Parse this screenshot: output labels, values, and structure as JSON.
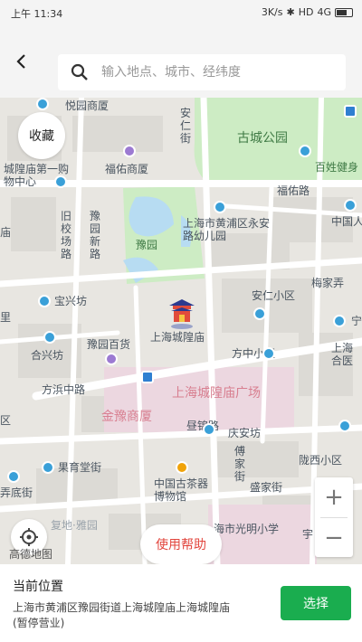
{
  "statusbar": {
    "time": "上午 11:34",
    "network": "3K/s",
    "hd": "HD",
    "signal": "4G"
  },
  "search": {
    "placeholder": "输入地点、城市、经纬度"
  },
  "map": {
    "favorite_label": "收藏",
    "help_label": "使用帮助",
    "labels": {
      "yuyuan_rest": "悦园商厦",
      "anren": "安仁街",
      "gucheng": "古城公园",
      "fuyou": "福佑商厦",
      "baixing": "百姓健身",
      "chenghuang_sh": "城隍庙第一购物中心",
      "fuyou_road": "福佑路",
      "zhongguoren": "中国人",
      "yuyuan_garden": "豫园",
      "jiuxiao": "旧校场路",
      "yuyuanxinlu": "豫园新路",
      "huangpu_kg": "上海市黄浦区永安路幼儿园",
      "miao": "庙",
      "baoxing": "宝兴坊",
      "anren_xq": "安仁小区",
      "meijia": "梅家弄",
      "li": "里",
      "ning": "宁",
      "hexing": "合兴坊",
      "yuyuan_bh": "豫园百货",
      "chenghuangmiao": "上海城隍庙",
      "fangzhong": "方中小区",
      "shanghai_he": "上海合医",
      "fangbang": "方浜中路",
      "chm_square": "上海城隍庙广场",
      "jinyu": "金豫商厦",
      "chanyuan": "昼锦路",
      "qu": "区",
      "qingan": "庆安坊",
      "fuxing": "傅家街",
      "longmen": "陇西小区",
      "guoyuan": "果育堂街",
      "nong": "弄底街",
      "tea": "中国古茶器博物馆",
      "shengjia": "盛家街",
      "fuxing_ya": "复地·雅园",
      "guangming": "海市光明小学",
      "shi": "宇"
    },
    "logo_text": "高德地图"
  },
  "bottom": {
    "title": "当前位置",
    "address": "上海市黄浦区豫园街道上海城隍庙上海城隍庙(暂停营业)",
    "select_label": "选择"
  },
  "colors": {
    "accent": "#1aad4f",
    "help_red": "#e2453d",
    "park_green": "#cdecc4"
  }
}
